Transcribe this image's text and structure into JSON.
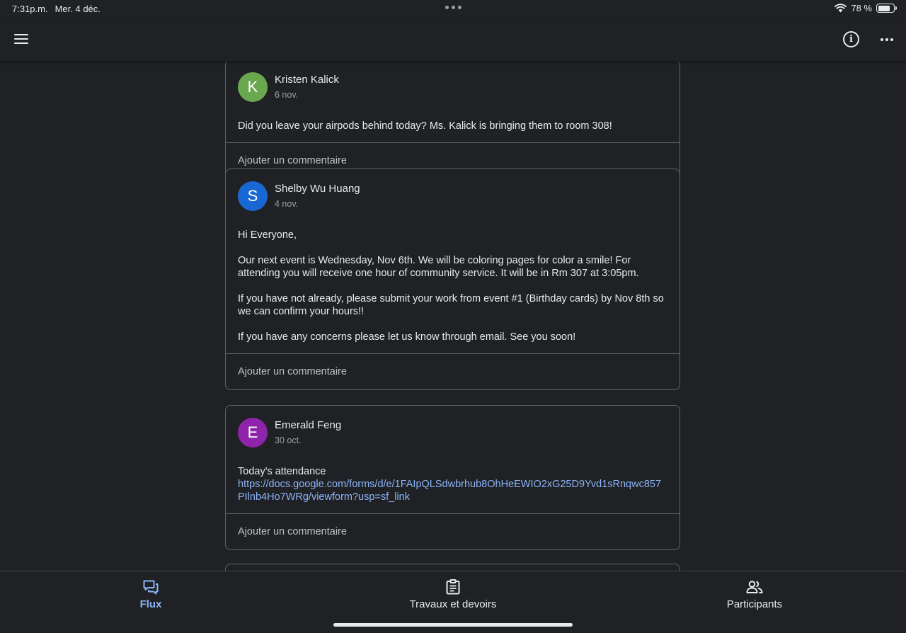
{
  "status_bar": {
    "time": "7:31p.m.",
    "date": "Mer. 4 déc.",
    "battery": "78 %",
    "battery_level": 0.78
  },
  "posts": [
    {
      "avatar_letter": "K",
      "avatar_color": "#6aa84f",
      "author": "Kristen Kalick",
      "date": "6 nov.",
      "paragraphs": [
        "Did you leave your airpods behind today? Ms. Kalick is bringing them to room 308!"
      ],
      "comment_label": "Ajouter un commentaire"
    },
    {
      "avatar_letter": "S",
      "avatar_color": "#1967d2",
      "author": "Shelby Wu Huang",
      "date": "4 nov.",
      "paragraphs": [
        "Hi Everyone,",
        "Our next event is Wednesday, Nov 6th. We will be coloring pages for color a smile! For attending you will receive one hour of community service. It will be in Rm 307 at 3:05pm.",
        "If you have not already, please submit your work from event #1 (Birthday cards) by Nov 8th so we can confirm your hours!!",
        "If you have any concerns please let us know through email. See you soon!"
      ],
      "comment_label": "Ajouter un commentaire"
    },
    {
      "avatar_letter": "E",
      "avatar_color": "#8e24aa",
      "author": "Emerald Feng",
      "date": "30 oct.",
      "text": "Today's attendance",
      "link": "https://docs.google.com/forms/d/e/1FAIpQLSdwbrhub8OhHeEWIO2xG25D9Yvd1sRnqwc857PIlnb4Ho7WRg/viewform?usp=sf_link",
      "comment_label": "Ajouter un commentaire"
    }
  ],
  "nav": {
    "stream": "Flux",
    "classwork": "Travaux et devoirs",
    "people": "Participants"
  },
  "colors": {
    "accent": "#8ab4f8",
    "background": "#202124",
    "border": "#5f6368"
  },
  "icons": {
    "menu": "menu-icon",
    "info": "info-icon",
    "more": "more-horizontal-icon",
    "wifi": "wifi-icon",
    "battery": "battery-icon",
    "stream": "stream-icon",
    "classwork": "classwork-icon",
    "people": "people-icon"
  }
}
